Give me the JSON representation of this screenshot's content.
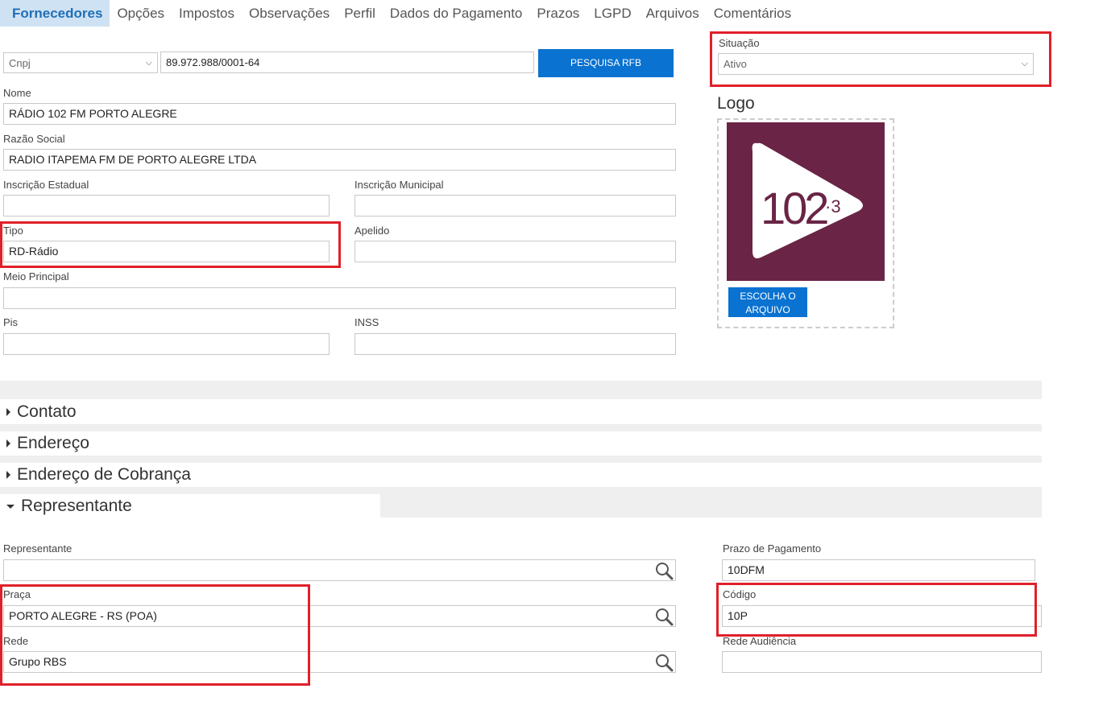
{
  "tabs": [
    "Fornecedores",
    "Opções",
    "Impostos",
    "Observações",
    "Perfil",
    "Dados do Pagamento",
    "Prazos",
    "LGPD",
    "Arquivos",
    "Comentários"
  ],
  "doc": {
    "type_value": "Cnpj",
    "number_value": "89.972.988/0001-64",
    "search_button": "PESQUISA RFB"
  },
  "situacao": {
    "label": "Situação",
    "value": "Ativo"
  },
  "logo": {
    "title": "Logo",
    "choose_button": "ESCOLHA O ARQUIVO",
    "brand_text": "102",
    "brand_sub": "·3",
    "brand_bg": "#6a2446"
  },
  "fields": {
    "nome": {
      "label": "Nome",
      "value": "RÁDIO 102 FM PORTO ALEGRE"
    },
    "razao": {
      "label": "Razão Social",
      "value": "RADIO ITAPEMA FM DE PORTO ALEGRE LTDA"
    },
    "insc_est": {
      "label": "Inscrição Estadual",
      "value": ""
    },
    "insc_mun": {
      "label": "Inscrição Municipal",
      "value": ""
    },
    "tipo": {
      "label": "Tipo",
      "value": "RD-Rádio"
    },
    "apelido": {
      "label": "Apelido",
      "value": ""
    },
    "meio": {
      "label": "Meio Principal",
      "value": ""
    },
    "pis": {
      "label": "Pis",
      "value": ""
    },
    "inss": {
      "label": "INSS",
      "value": ""
    }
  },
  "sections": {
    "contato": "Contato",
    "endereco": "Endereço",
    "cobranca": "Endereço de Cobrança",
    "representante": "Representante"
  },
  "rep": {
    "representante": {
      "label": "Representante",
      "value": ""
    },
    "prazo": {
      "label": "Prazo de Pagamento",
      "value": "10DFM"
    },
    "praca": {
      "label": "Praça",
      "value": "PORTO ALEGRE - RS (POA)"
    },
    "codigo": {
      "label": "Código",
      "value": "10P"
    },
    "rede": {
      "label": "Rede",
      "value": "Grupo RBS"
    },
    "rede_audiencia": {
      "label": "Rede Audiência",
      "value": ""
    }
  },
  "colors": {
    "accent": "#0a72d1",
    "highlight": "#e0202a",
    "active_tab_bg": "#cfe2f3"
  }
}
